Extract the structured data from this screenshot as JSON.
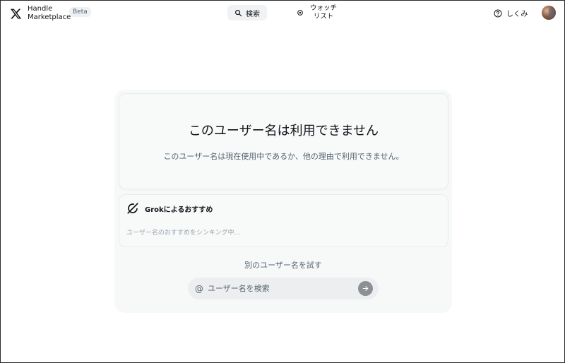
{
  "header": {
    "brand_line1": "Handle",
    "brand_line2": "Marketplace",
    "beta_label": "Beta",
    "search_label": "検索",
    "watchlist_line1": "ウォッチ",
    "watchlist_line2": "リスト",
    "how_label": "しくみ"
  },
  "main": {
    "title": "このユーザー名は利用できません",
    "subtitle": "このユーザー名は現在使用中であるか、他の理由で利用できません。",
    "grok": {
      "heading": "Grokによるおすすめ",
      "status": "ユーザー名のおすすめをシンキング中..."
    },
    "try_label": "別のユーザー名を試す",
    "search": {
      "prefix": "@",
      "placeholder": "ユーザー名を検索"
    }
  },
  "icons": {
    "brand": "x-logo-icon",
    "search": "search-icon",
    "watchlist": "eye-icon",
    "how": "question-circle-icon",
    "grok": "grok-icon",
    "submit": "arrow-right-icon"
  },
  "colors": {
    "text_primary": "#0f1419",
    "text_secondary": "#536471",
    "card_bg": "#f8f9f9",
    "submit_button": "#8b9094"
  }
}
